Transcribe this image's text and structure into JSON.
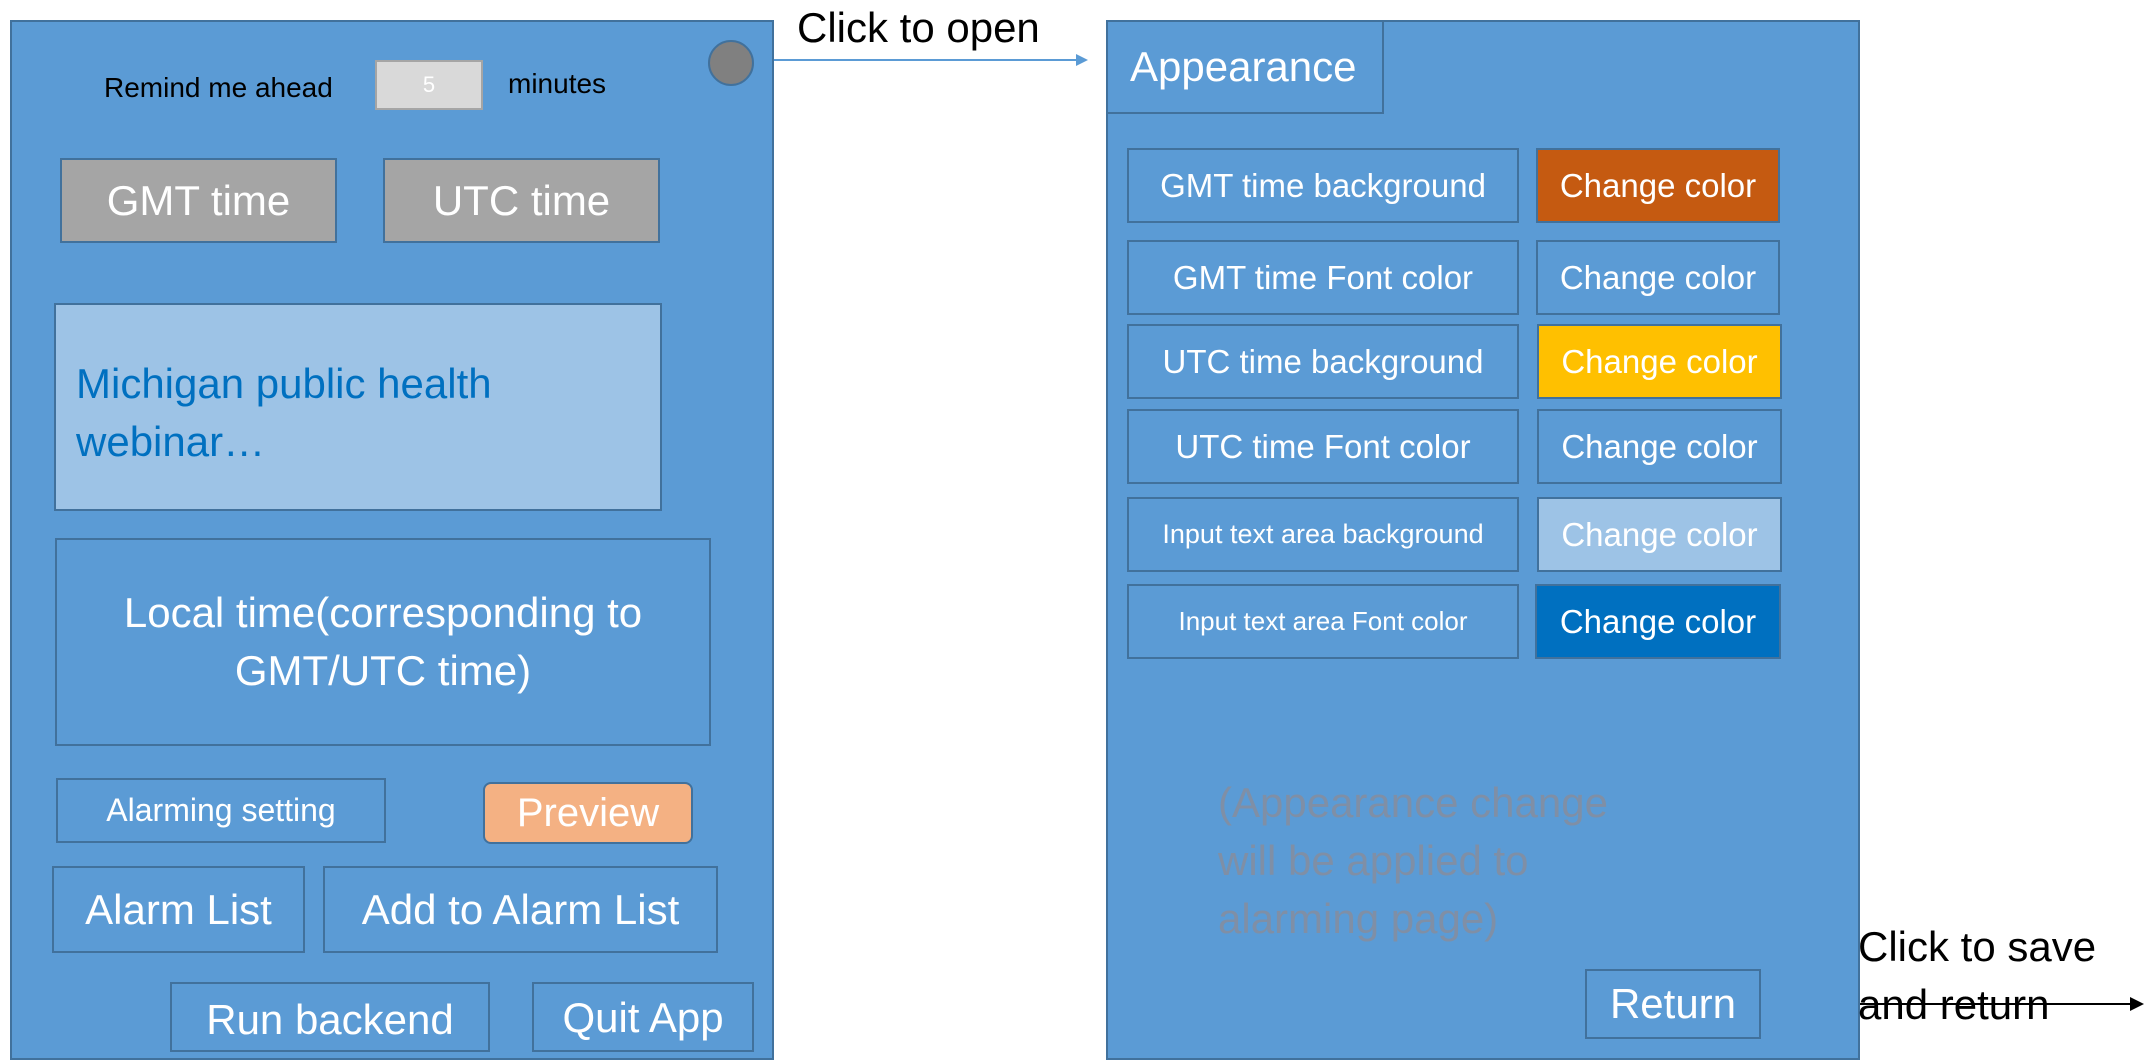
{
  "left": {
    "remind_label": "Remind me ahead",
    "remind_value": "5",
    "minutes_label": "minutes",
    "gmt_button": "GMT time",
    "utc_button": "UTC time",
    "reminder_text": "Michigan public health webinar…",
    "local_time": "Local time(corresponding to GMT/UTC time)",
    "alarming_setting": "Alarming setting",
    "preview": "Preview",
    "alarm_list": "Alarm List",
    "add_alarm": "Add to Alarm List",
    "run_backend": "Run backend",
    "quit_app": "Quit App"
  },
  "annotations": {
    "open": "Click to open",
    "save_return": "Click to save and return"
  },
  "right": {
    "tab": "Appearance",
    "rows": [
      {
        "label": "GMT time background",
        "button": "Change color",
        "swatch": "#c55a11"
      },
      {
        "label": "GMT time Font color",
        "button": "Change color",
        "swatch": "#5b9bd5"
      },
      {
        "label": "UTC time background",
        "button": "Change color",
        "swatch": "#ffc000"
      },
      {
        "label": "UTC time Font color",
        "button": "Change color",
        "swatch": "#5b9bd5"
      },
      {
        "label": "Input text area background",
        "button": "Change color",
        "swatch": "#9dc3e6"
      },
      {
        "label": "Input text area Font color",
        "button": "Change color",
        "swatch": "#0070c0"
      }
    ],
    "note": "(Appearance change will be applied to alarming page)",
    "return": "Return"
  },
  "colors": {
    "panel": "#5b9bd5",
    "border": "#41719c",
    "gray_button": "#a5a5a5",
    "preview": "#f4b183",
    "text_area": "#9dc3e6",
    "text_area_font": "#0070c0",
    "note": "#7f8fa6"
  }
}
